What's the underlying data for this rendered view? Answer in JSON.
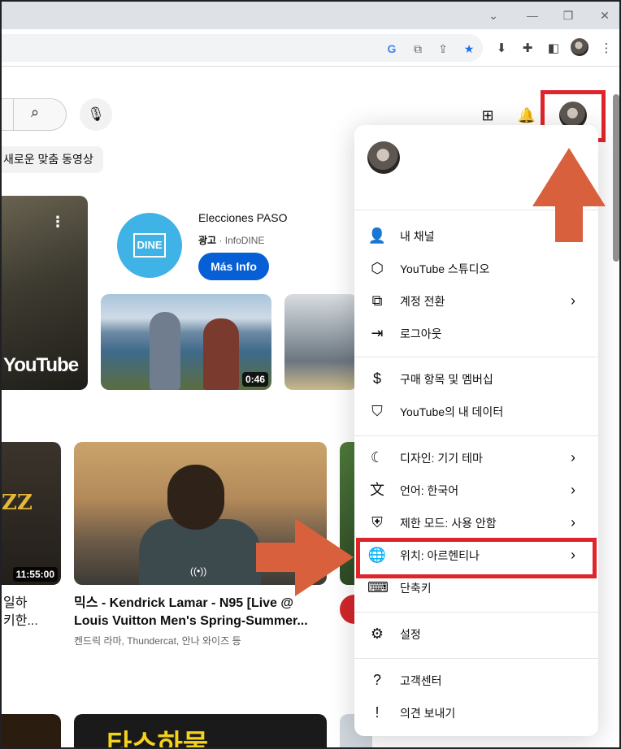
{
  "browser": {
    "window_controls": [
      "⌄",
      "—",
      "❐",
      "✕"
    ],
    "toolbar_icons": [
      "google-icon",
      "open-in-new-icon",
      "share-icon",
      "star-icon",
      "download-icon",
      "extensions-icon",
      "side-panel-icon",
      "profile-avatar",
      "more-icon"
    ]
  },
  "youtube": {
    "chip_label": "새로운 맞춤 동영상",
    "ad": {
      "title": "Elecciones PASO",
      "ad_label": "광고",
      "advertiser": "InfoDINE",
      "logo_text": "DINE",
      "button": "Más Info"
    },
    "thumb_logo_text": "YouTube",
    "video_lake_duration": "0:46",
    "jazz_text": "ZZ",
    "jazz_duration": "11:55:00",
    "left_video_title": "일하\n키한...",
    "kendrick_video": {
      "title": "믹스 - Kendrick Lamar - N95 [Live @ Louis Vuitton Men's Spring-Summer...",
      "meta": "켄드릭 라마, Thundercat, 안나 와이즈 등"
    },
    "bottom_thumb_text": "타스하물"
  },
  "account_menu": {
    "sections": [
      [
        {
          "icon": "person-icon",
          "label": "내 채널",
          "chevron": false
        },
        {
          "icon": "studio-icon",
          "label": "YouTube 스튜디오",
          "chevron": false
        },
        {
          "icon": "switch-account-icon",
          "label": "계정 전환",
          "chevron": true
        },
        {
          "icon": "logout-icon",
          "label": "로그아웃",
          "chevron": false
        }
      ],
      [
        {
          "icon": "dollar-icon",
          "label": "구매 항목 및 멤버십",
          "chevron": false
        },
        {
          "icon": "shield-person-icon",
          "label": "YouTube의 내 데이터",
          "chevron": false
        }
      ],
      [
        {
          "icon": "moon-icon",
          "label": "디자인: 기기 테마",
          "chevron": true
        },
        {
          "icon": "translate-icon",
          "label": "언어: 한국어",
          "chevron": true
        },
        {
          "icon": "restricted-icon",
          "label": "제한 모드: 사용 안함",
          "chevron": true
        },
        {
          "icon": "globe-icon",
          "label": "위치: 아르헨티나",
          "chevron": true
        },
        {
          "icon": "keyboard-icon",
          "label": "단축키",
          "chevron": false
        }
      ],
      [
        {
          "icon": "gear-icon",
          "label": "설정",
          "chevron": false
        }
      ],
      [
        {
          "icon": "help-icon",
          "label": "고객센터",
          "chevron": false
        },
        {
          "icon": "feedback-icon",
          "label": "의견 보내기",
          "chevron": false
        }
      ]
    ]
  },
  "colors": {
    "highlight_red": "#e0242b",
    "arrow_orange": "#d9603c",
    "youtube_blue": "#065fd4"
  }
}
